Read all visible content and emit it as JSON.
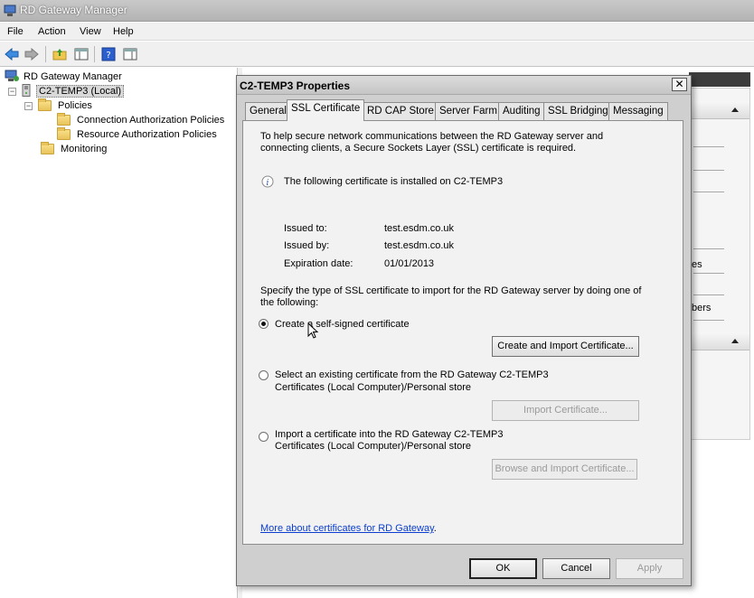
{
  "window": {
    "title": "RD Gateway Manager"
  },
  "menu": [
    "File",
    "Action",
    "View",
    "Help"
  ],
  "tree": {
    "root": "RD Gateway Manager",
    "server": "C2-TEMP3 (Local)",
    "policies": "Policies",
    "cap": "Connection Authorization Policies",
    "rap": "Resource Authorization Policies",
    "monitoring": "Monitoring"
  },
  "background_actions": {
    "fragment_1": "es",
    "fragment_2": "bers"
  },
  "dialog": {
    "title": "C2-TEMP3 Properties",
    "close": "✕",
    "tabs": [
      "General",
      "SSL Certificate",
      "RD CAP Store",
      "Server Farm",
      "Auditing",
      "SSL Bridging",
      "Messaging"
    ],
    "active_tab": "SSL Certificate",
    "intro_line1": "To help secure network communications between the RD Gateway server and",
    "intro_line2": "connecting clients, a Secure Sockets Layer (SSL) certificate is required.",
    "info_text": "The following certificate is installed on C2-TEMP3",
    "issued_to_label": "Issued to:",
    "issued_to_value": "test.esdm.co.uk",
    "issued_by_label": "Issued by:",
    "issued_by_value": "test.esdm.co.uk",
    "expiration_label": "Expiration date:",
    "expiration_value": "01/01/2013",
    "specify_line1": "Specify the type of SSL certificate to import for the RD Gateway server by doing one of",
    "specify_line2": "the following:",
    "option1": "Create a self-signed certificate",
    "option1_button": "Create and Import Certificate...",
    "option2_line1": "Select an existing certificate from the RD Gateway C2-TEMP3",
    "option2_line2": "Certificates (Local Computer)/Personal store",
    "option2_button": "Import Certificate...",
    "option3_line1": "Import a certificate into the RD Gateway C2-TEMP3",
    "option3_line2": "Certificates (Local Computer)/Personal store",
    "option3_button": "Browse and Import Certificate...",
    "link": "More about certificates for RD Gateway",
    "link_suffix": ".",
    "ok": "OK",
    "cancel": "Cancel",
    "apply": "Apply"
  },
  "colors": {
    "link": "#0b3ecf",
    "dialog_bg": "#cfcfcf",
    "panel_bg": "#f2f2f2"
  }
}
